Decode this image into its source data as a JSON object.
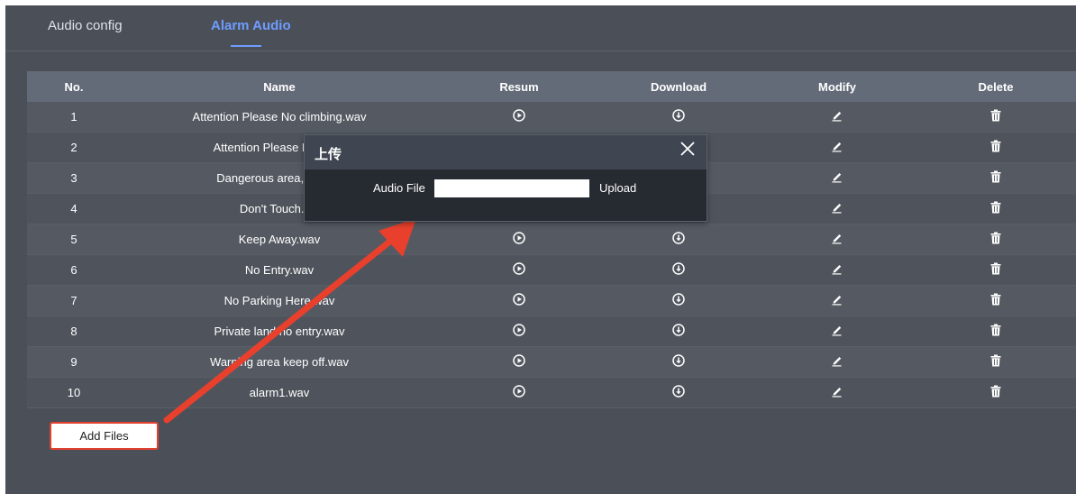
{
  "tabs": [
    {
      "label": "Audio config",
      "active": false
    },
    {
      "label": "Alarm Audio",
      "active": true
    }
  ],
  "table": {
    "headers": {
      "no": "No.",
      "name": "Name",
      "resum": "Resum",
      "download": "Download",
      "modify": "Modify",
      "delete": "Delete"
    },
    "rows": [
      {
        "no": "1",
        "name": "Attention Please No climbing.wav"
      },
      {
        "no": "2",
        "name": "Attention Please No parki"
      },
      {
        "no": "3",
        "name": "Dangerous area, keep a"
      },
      {
        "no": "4",
        "name": "Don't Touch.wa"
      },
      {
        "no": "5",
        "name": "Keep Away.wav"
      },
      {
        "no": "6",
        "name": "No Entry.wav"
      },
      {
        "no": "7",
        "name": "No Parking Here.wav"
      },
      {
        "no": "8",
        "name": "Private land no entry.wav"
      },
      {
        "no": "9",
        "name": "Warning area keep off.wav"
      },
      {
        "no": "10",
        "name": "alarm1.wav"
      }
    ]
  },
  "add_files_label": "Add Files",
  "dialog": {
    "title": "上传",
    "audio_file_label": "Audio File",
    "audio_file_value": "",
    "upload_label": "Upload"
  },
  "colors": {
    "accent": "#6e9cff",
    "highlight": "#e2412f",
    "background": "#4b5058"
  }
}
